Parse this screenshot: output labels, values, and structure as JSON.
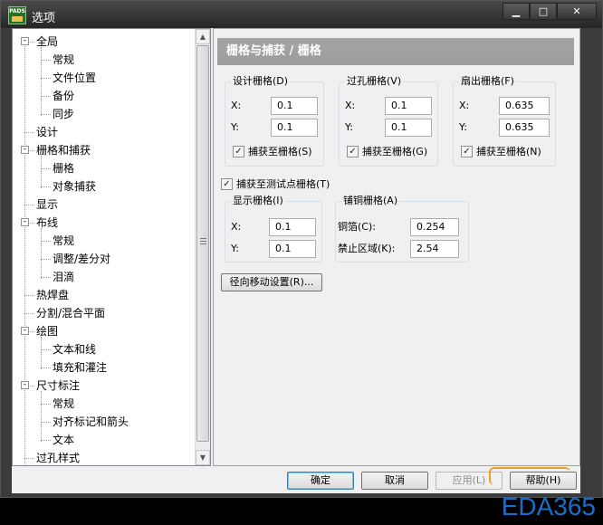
{
  "window": {
    "title": "选项",
    "icon_text": "PADS",
    "buttons": {
      "minimize": "▁",
      "maximize": "□",
      "close": "✕"
    }
  },
  "tree": {
    "items": [
      {
        "label": "全局",
        "level": 0,
        "expander": "-"
      },
      {
        "label": "常规",
        "level": 1
      },
      {
        "label": "文件位置",
        "level": 1
      },
      {
        "label": "备份",
        "level": 1
      },
      {
        "label": "同步",
        "level": 1
      },
      {
        "label": "设计",
        "level": 0
      },
      {
        "label": "栅格和捕获",
        "level": 0,
        "expander": "-"
      },
      {
        "label": "栅格",
        "level": 1,
        "selected": true
      },
      {
        "label": "对象捕获",
        "level": 1
      },
      {
        "label": "显示",
        "level": 0
      },
      {
        "label": "布线",
        "level": 0,
        "expander": "-"
      },
      {
        "label": "常规",
        "level": 1
      },
      {
        "label": "调整/差分对",
        "level": 1
      },
      {
        "label": "泪滴",
        "level": 1
      },
      {
        "label": "热焊盘",
        "level": 0
      },
      {
        "label": "分割/混合平面",
        "level": 0
      },
      {
        "label": "绘图",
        "level": 0,
        "expander": "-"
      },
      {
        "label": "文本和线",
        "level": 1
      },
      {
        "label": "填充和灌注",
        "level": 1
      },
      {
        "label": "尺寸标注",
        "level": 0,
        "expander": "-"
      },
      {
        "label": "常规",
        "level": 1
      },
      {
        "label": "对齐标记和箭头",
        "level": 1
      },
      {
        "label": "文本",
        "level": 1
      },
      {
        "label": "过孔样式",
        "level": 0
      }
    ],
    "scroll_up": "▲",
    "scroll_down": "▼"
  },
  "panel": {
    "header": "栅格与捕获 / 栅格",
    "design_grid": {
      "title": "设计栅格(D)",
      "x_label": "X:",
      "x_value": "0.1",
      "y_label": "Y:",
      "y_value": "0.1",
      "snap_label": "捕获至栅格(S)",
      "snap_checked": true
    },
    "via_grid": {
      "title": "过孔栅格(V)",
      "x_label": "X:",
      "x_value": "0.1",
      "y_label": "Y:",
      "y_value": "0.1",
      "snap_label": "捕获至栅格(G)",
      "snap_checked": true
    },
    "fanout_grid": {
      "title": "扇出栅格(F)",
      "x_label": "X:",
      "x_value": "0.635",
      "y_label": "Y:",
      "y_value": "0.635",
      "snap_label": "捕获至栅格(N)",
      "snap_checked": true
    },
    "snap_testpoint": {
      "label": "捕获至测试点栅格(T)",
      "checked": true
    },
    "display_grid": {
      "title": "显示栅格(I)",
      "x_label": "X:",
      "x_value": "0.1",
      "y_label": "Y:",
      "y_value": "0.1"
    },
    "copper_grid": {
      "title": "铺铜栅格(A)",
      "copper_label": "铜箔(C):",
      "copper_value": "0.254",
      "keepout_label": "禁止区域(K):",
      "keepout_value": "2.54"
    },
    "radial_button": "径向移动设置(R)..."
  },
  "footer": {
    "ok": "确定",
    "cancel": "取消",
    "apply": "应用(L)",
    "help": "帮助(H)"
  },
  "watermark": "EDA365",
  "check_mark": "✓"
}
